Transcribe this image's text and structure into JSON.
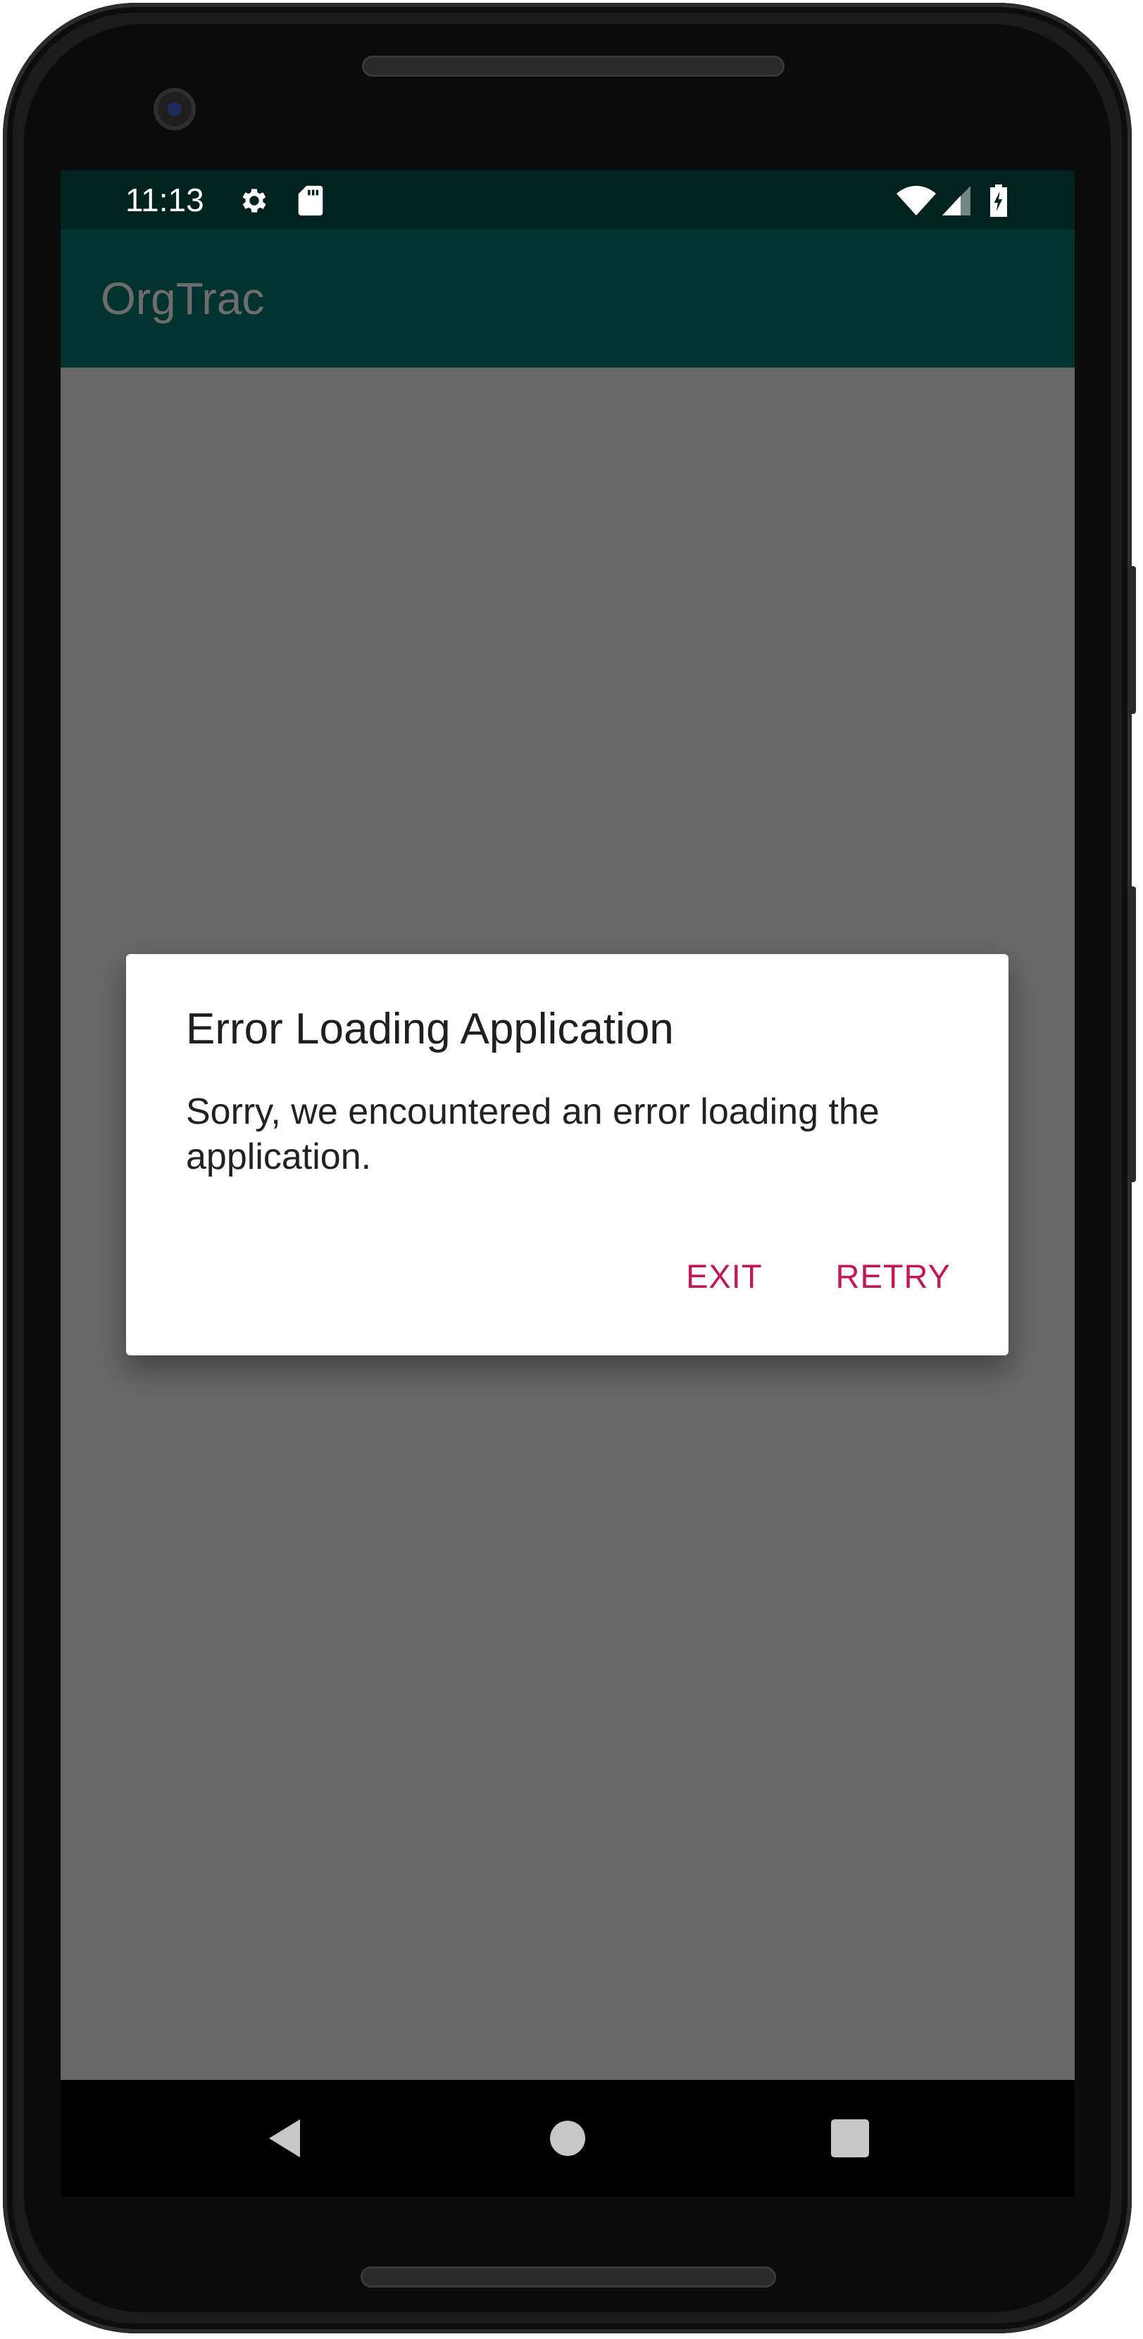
{
  "status_bar": {
    "time": "11:13",
    "icons": [
      "settings-icon",
      "sd-card-icon",
      "wifi-icon",
      "signal-icon",
      "battery-charging-icon"
    ]
  },
  "app_bar": {
    "title": "OrgTrac"
  },
  "dialog": {
    "title": "Error Loading Application",
    "message": "Sorry, we encountered an error loading the application.",
    "exit_label": "EXIT",
    "retry_label": "RETRY"
  },
  "nav_bar": {
    "buttons": [
      "back-icon",
      "home-icon",
      "recents-icon"
    ]
  },
  "colors": {
    "status_bar": "#01231f",
    "app_bar": "#03332e",
    "scrim_background": "#676767",
    "dialog_button": "#c0185a",
    "nav_bar": "#000000"
  }
}
